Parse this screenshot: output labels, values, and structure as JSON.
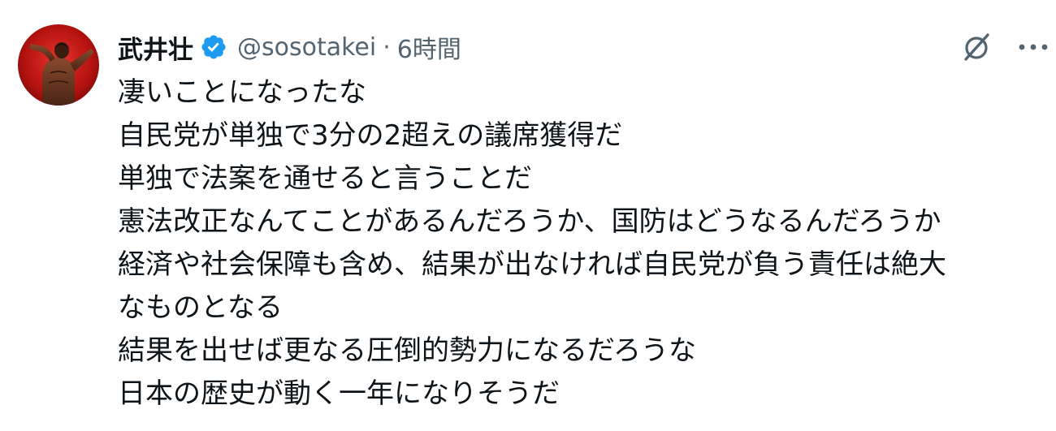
{
  "author": {
    "display_name": "武井壮",
    "handle": "@sosotakei",
    "separator": "·",
    "timestamp": "6時間",
    "verified": true
  },
  "icons": {
    "verified": "verified-badge-icon",
    "grok": "grok-icon",
    "more": "more-options-icon"
  },
  "colors": {
    "verified_badge": "#1d9bf0",
    "secondary_text": "#536471",
    "primary_text": "#0f1419"
  },
  "tweet": {
    "lines": [
      "凄いことになったな",
      "自民党が単独で3分の2超えの議席獲得だ",
      "単独で法案を通せると言うことだ",
      "憲法改正なんてことがあるんだろうか、国防はどうなるんだろうか",
      "経済や社会保障も含め、結果が出なければ自民党が負う責任は絶大",
      "なものとなる",
      "結果を出せば更なる圧倒的勢力になるだろうな",
      "日本の歴史が動く一年になりそうだ"
    ]
  }
}
